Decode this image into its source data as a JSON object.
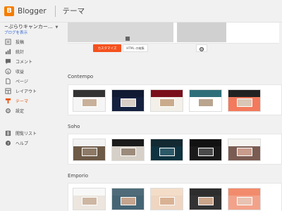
{
  "app": {
    "brand": "Blogger",
    "section": "テーマ"
  },
  "sidebar": {
    "blog_name": "~ぶらりキャンカー...",
    "view_blog": "ブログを表示",
    "items": [
      {
        "label": "投稿",
        "icon": "posts-icon",
        "active": false
      },
      {
        "label": "統計",
        "icon": "stats-icon",
        "active": false
      },
      {
        "label": "コメント",
        "icon": "comments-icon",
        "active": false
      },
      {
        "label": "収益",
        "icon": "earnings-icon",
        "active": false
      },
      {
        "label": "ページ",
        "icon": "pages-icon",
        "active": false
      },
      {
        "label": "レイアウト",
        "icon": "layout-icon",
        "active": false
      },
      {
        "label": "テーマ",
        "icon": "theme-icon",
        "active": true
      },
      {
        "label": "設定",
        "icon": "settings-icon",
        "active": false
      },
      {
        "label": "閲覧リスト",
        "icon": "reading-list-icon",
        "active": false
      },
      {
        "label": "ヘルプ",
        "icon": "help-icon",
        "active": false
      }
    ]
  },
  "current_theme": {
    "customize_label": "カスタマイズ",
    "edit_html_label": "HTML の編集"
  },
  "groups": [
    {
      "title": "Contempo",
      "themes": [
        {
          "header": "#333333",
          "body": "#f5f5f5"
        },
        {
          "header": "#111a33",
          "body": "#15213f"
        },
        {
          "header": "#7a0f1c",
          "body": "#f3efe9"
        },
        {
          "header": "#2f6f7a",
          "body": "#ffffff"
        },
        {
          "header": "#222222",
          "body": "#f37a5c"
        }
      ]
    },
    {
      "title": "Soho",
      "themes": [
        {
          "header": "#f2f2f2",
          "body": "#6d5a47"
        },
        {
          "header": "#1b1b1b",
          "body": "#d6d0c8"
        },
        {
          "header": "#132a33",
          "body": "#0f3340"
        },
        {
          "header": "#121212",
          "body": "#1a1a1a"
        },
        {
          "header": "#f5f3f0",
          "body": "#7b5c52"
        }
      ]
    },
    {
      "title": "Emporio",
      "themes": [
        {
          "header": "#f8f8f8",
          "body": "#ece6df"
        },
        {
          "header": "#4f6b7a",
          "body": "#466574"
        },
        {
          "header": "#f3ddc8",
          "body": "#eed6c2"
        },
        {
          "header": "#2d2d2d",
          "body": "#333333"
        },
        {
          "header": "#f28b6c",
          "body": "#f3a28a"
        }
      ]
    }
  ],
  "colors": {
    "accent": "#e8520c",
    "brand": "#f57d00",
    "link": "#3367d6"
  }
}
